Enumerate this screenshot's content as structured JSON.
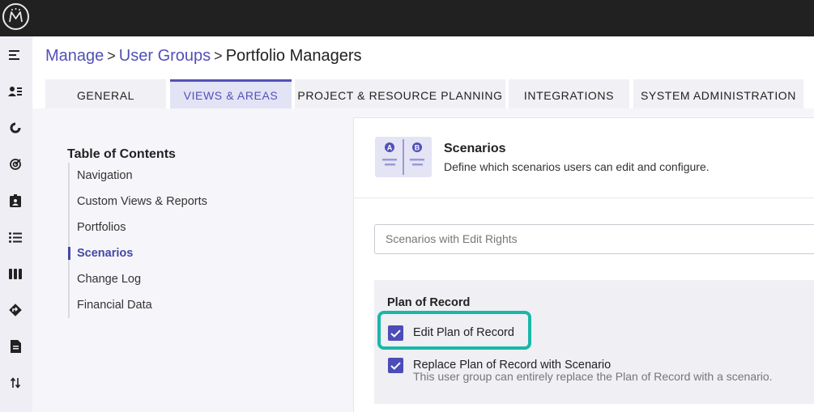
{
  "app": {
    "logo_icon": "monogram-logo-icon"
  },
  "rail": {
    "items": [
      {
        "icon": "menu-collapse-icon"
      },
      {
        "icon": "users-list-icon"
      },
      {
        "icon": "pie-chart-icon"
      },
      {
        "icon": "target-icon"
      },
      {
        "icon": "badge-icon"
      },
      {
        "icon": "list-icon"
      },
      {
        "icon": "columns-icon"
      },
      {
        "icon": "roadmap-icon"
      },
      {
        "icon": "document-icon"
      },
      {
        "icon": "sort-arrows-icon"
      }
    ]
  },
  "breadcrumb": {
    "items": [
      "Manage",
      "User Groups",
      "Portfolio Managers"
    ],
    "separator": ">"
  },
  "tabs": [
    {
      "label": "GENERAL",
      "active": false
    },
    {
      "label": "VIEWS & AREAS",
      "active": true
    },
    {
      "label": "PROJECT & RESOURCE PLANNING",
      "active": false
    },
    {
      "label": "INTEGRATIONS",
      "active": false
    },
    {
      "label": "SYSTEM ADMINISTRATION",
      "active": false
    }
  ],
  "toc": {
    "title": "Table of Contents",
    "items": [
      {
        "label": "Navigation"
      },
      {
        "label": "Custom Views & Reports"
      },
      {
        "label": "Portfolios"
      },
      {
        "label": "Scenarios",
        "active": true
      },
      {
        "label": "Change Log"
      },
      {
        "label": "Financial Data"
      }
    ]
  },
  "scenarios": {
    "icon": "scenario-ab-icon",
    "icon_letters": [
      "A",
      "B"
    ],
    "title": "Scenarios",
    "description": "Define which scenarios users can edit and configure.",
    "select_placeholder": "Scenarios with Edit Rights",
    "plan_of_record": {
      "title": "Plan of Record",
      "edit": {
        "label": "Edit Plan of Record",
        "checked": true
      },
      "replace": {
        "label": "Replace Plan of Record with Scenario",
        "checked": true
      },
      "help": "This user group can entirely replace the Plan of Record with a scenario."
    }
  },
  "colors": {
    "accent": "#5151b8",
    "highlight": "#18b8a8",
    "topbar": "#212121"
  }
}
